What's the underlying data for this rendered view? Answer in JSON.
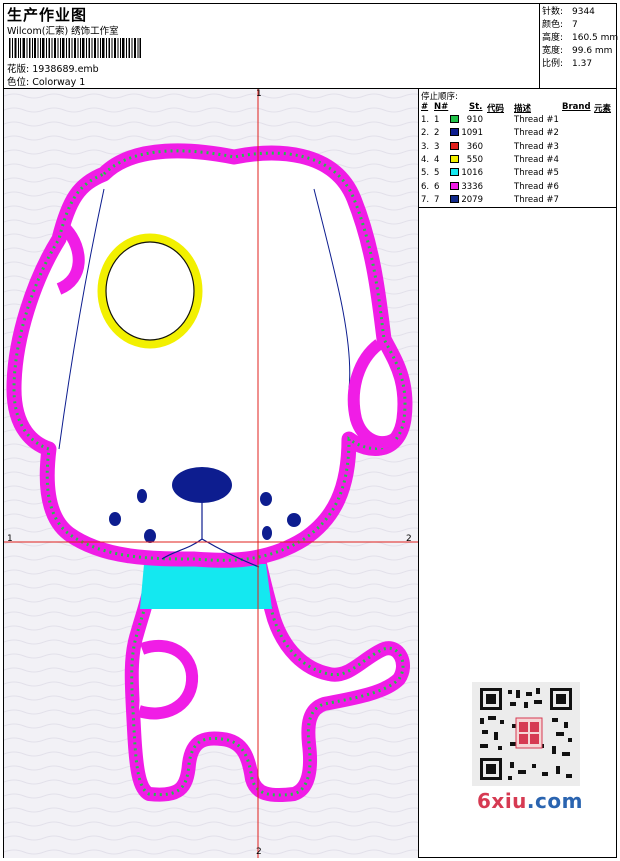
{
  "header": {
    "title": "生产作业图",
    "company": "Wilcom(汇索) 绣饰工作室",
    "design_label": "花版:",
    "design_value": "1938689.emb",
    "colorway_label": "色位:",
    "colorway_value": "Colorway 1"
  },
  "stats": [
    {
      "label": "针数:",
      "value": "9344"
    },
    {
      "label": "颜色:",
      "value": "7"
    },
    {
      "label": "高度:",
      "value": "160.5 mm"
    },
    {
      "label": "宽度:",
      "value": "99.6 mm"
    },
    {
      "label": "比例:",
      "value": "1.37"
    }
  ],
  "stop_sequence": {
    "title": "停止顺序:",
    "headers": {
      "num": "#",
      "n": "N#",
      "st": "St.",
      "code": "代码",
      "desc": "描述",
      "brand": "Brand",
      "element": "元素"
    },
    "rows": [
      {
        "num": "1.",
        "n": "1",
        "color": "#22c24a",
        "st": "910",
        "desc": "Thread #1"
      },
      {
        "num": "2.",
        "n": "2",
        "color": "#0d1d8f",
        "st": "1091",
        "desc": "Thread #2"
      },
      {
        "num": "3.",
        "n": "3",
        "color": "#e0201c",
        "st": "360",
        "desc": "Thread #3"
      },
      {
        "num": "4.",
        "n": "4",
        "color": "#f2f000",
        "st": "550",
        "desc": "Thread #4"
      },
      {
        "num": "5.",
        "n": "5",
        "color": "#14e8f0",
        "st": "1016",
        "desc": "Thread #5"
      },
      {
        "num": "6.",
        "n": "6",
        "color": "#f01de6",
        "st": "3336",
        "desc": "Thread #6"
      },
      {
        "num": "7.",
        "n": "7",
        "color": "#122a8a",
        "st": "2079",
        "desc": "Thread #7"
      }
    ]
  },
  "axis_labels": {
    "top": "1",
    "left": "1",
    "right": "2",
    "bottom": "2"
  },
  "watermark": {
    "main": "6xiu",
    "suffix": ".com"
  },
  "colors": {
    "outline": "#f01de6",
    "zigzag": "#22c24a",
    "navy": "#0d1d8f",
    "yellow": "#f2f000",
    "cyan": "#14e8f0",
    "crosshair": "#e0201c"
  }
}
